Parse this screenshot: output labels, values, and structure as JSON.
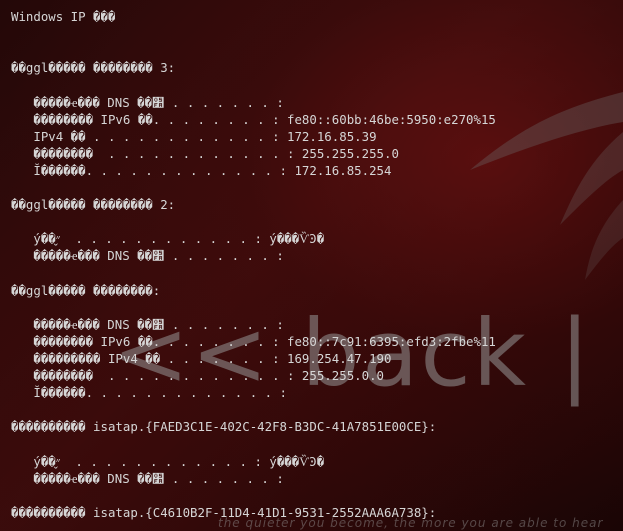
{
  "terminal": {
    "lines": [
      "Windows IP ���",
      "",
      "",
      "��ggl����� �������� 3:",
      "",
      "   �����ҽ��� DNS ��׺ . . . . . . . :",
      "   �������� IPv6 ��. . . . . . . . : fe80::60bb:46be:5950:e270%15",
      "   IPv4 �� . . . . . . . . . . . . : 172.16.85.39",
      "   ��������  . . . . . . . . . . . . : 255.255.255.0",
      "   Ĭ������. . . . . . . . . . . . . : 172.16.85.254",
      "",
      "��ggl����� �������� 2:",
      "",
      "   ý��״̬  . . . . . . . . . . . . : ý���ѶϿ�",
      "   �����ҽ��� DNS ��׺ . . . . . . . :",
      "",
      "��ggl����� ��������:",
      "",
      "   �����ҽ��� DNS ��׺ . . . . . . . :",
      "   �������� IPv6 ��. . . . . . . . : fe80::7c91:6395:efd3:2fbe%11",
      "   ��������� IPv4 �� . . . . . . . : 169.254.47.190",
      "   ��������  . . . . . . . . . . . . : 255.255.0.0",
      "   Ĭ������. . . . . . . . . . . . . :",
      "",
      "���������� isatap.{FAED3C1E-402C-42F8-B3DC-41A7851E00CE}:",
      "",
      "   ý��״̬  . . . . . . . . . . . . : ý���ѶϿ�",
      "   �����ҽ��� DNS ��׺ . . . . . . . :",
      "",
      "���������� isatap.{C4610B2F-11D4-41D1-9531-2552AAA6A738}:"
    ]
  },
  "wallpaper": {
    "logo_text": "<< back | track",
    "tagline": "the quieter you become, the more you are able to hear",
    "logo_color": "#969696",
    "background_color": "#2a0808"
  }
}
